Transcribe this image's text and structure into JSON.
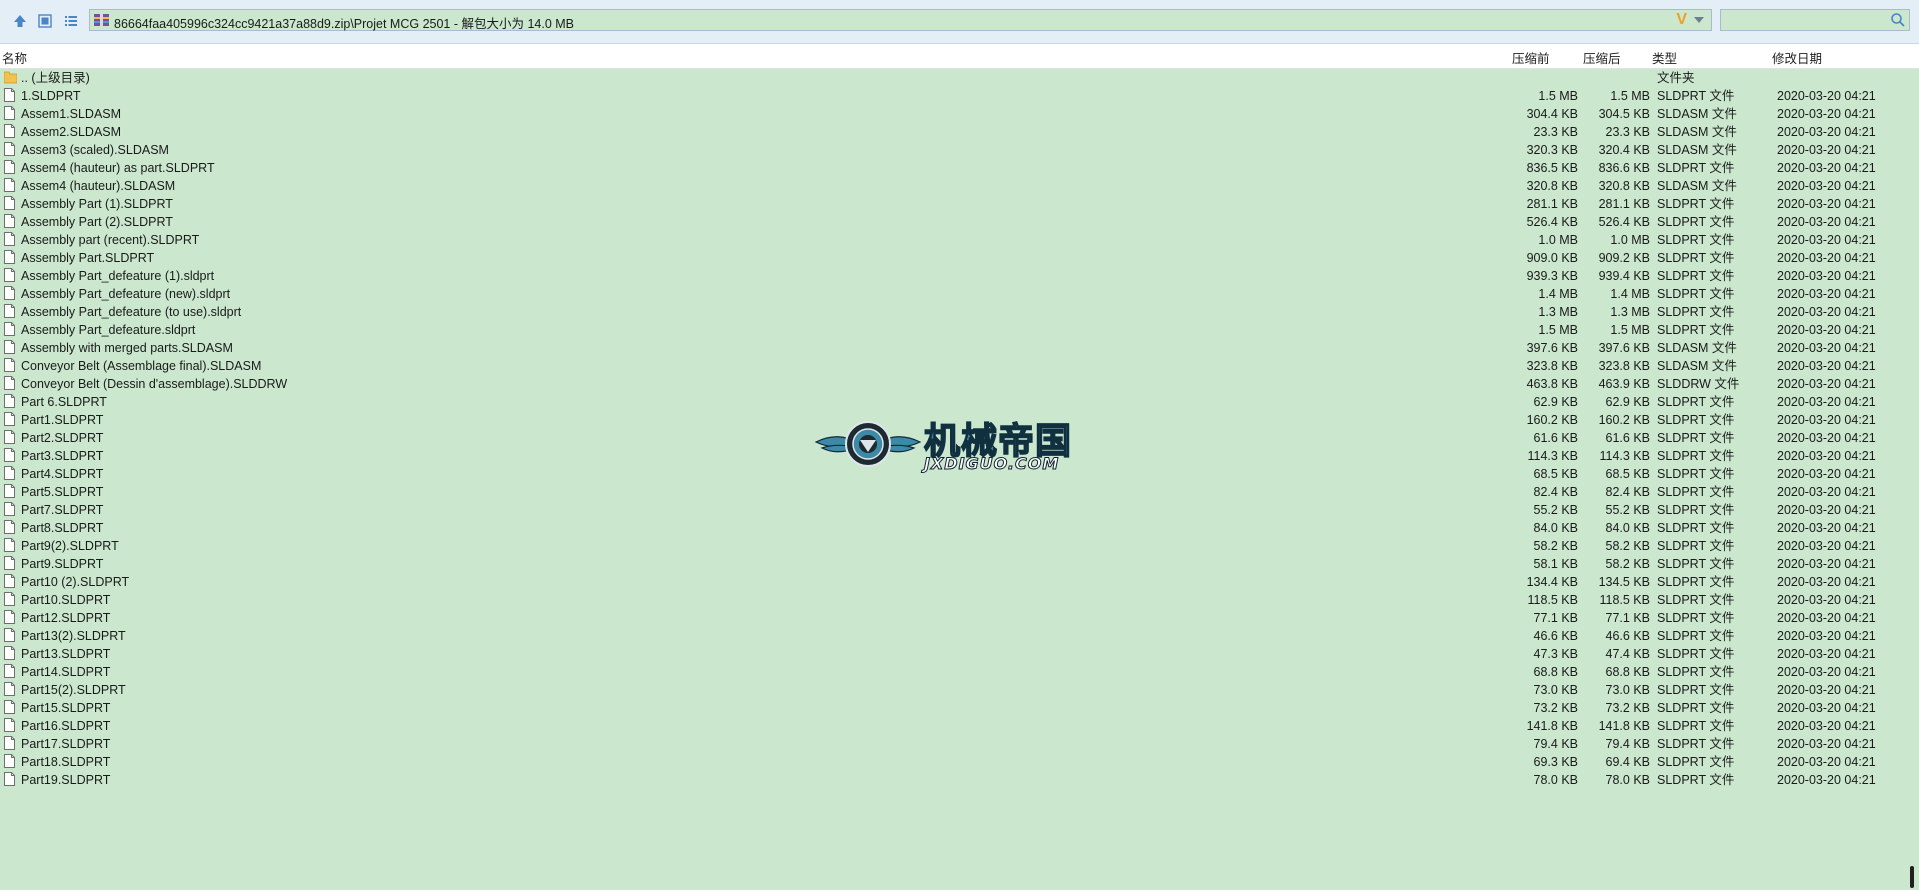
{
  "address": {
    "path": "86664faa405996c324cc9421a37a88d9.zip\\Projet MCG 2501 - 解包大小为 14.0 MB",
    "search_placeholder": ""
  },
  "columns": {
    "name": "名称",
    "compressed_before": "压缩前",
    "compressed_after": "压缩后",
    "type": "类型",
    "modified": "修改日期"
  },
  "watermark": {
    "brand_cn": "机械帝国",
    "brand_en": "JXDIGUO.COM"
  },
  "colors": {
    "background": "#cbe8cf",
    "toolbar": "#e3eef7",
    "header": "#ffffff",
    "folder": "#f2c14e",
    "accent_v": "#f0a020"
  },
  "rows": [
    {
      "name": ".. (上级目录)",
      "before": "",
      "after": "",
      "type": "文件夹",
      "date": "",
      "icon": "folder-icon"
    },
    {
      "name": "1.SLDPRT",
      "before": "1.5 MB",
      "after": "1.5 MB",
      "type": "SLDPRT 文件",
      "date": "2020-03-20 04:21",
      "icon": "file-icon"
    },
    {
      "name": "Assem1.SLDASM",
      "before": "304.4 KB",
      "after": "304.5 KB",
      "type": "SLDASM 文件",
      "date": "2020-03-20 04:21",
      "icon": "file-icon"
    },
    {
      "name": "Assem2.SLDASM",
      "before": "23.3 KB",
      "after": "23.3 KB",
      "type": "SLDASM 文件",
      "date": "2020-03-20 04:21",
      "icon": "file-icon"
    },
    {
      "name": "Assem3 (scaled).SLDASM",
      "before": "320.3 KB",
      "after": "320.4 KB",
      "type": "SLDASM 文件",
      "date": "2020-03-20 04:21",
      "icon": "file-icon"
    },
    {
      "name": "Assem4 (hauteur) as part.SLDPRT",
      "before": "836.5 KB",
      "after": "836.6 KB",
      "type": "SLDPRT 文件",
      "date": "2020-03-20 04:21",
      "icon": "file-icon"
    },
    {
      "name": "Assem4 (hauteur).SLDASM",
      "before": "320.8 KB",
      "after": "320.8 KB",
      "type": "SLDASM 文件",
      "date": "2020-03-20 04:21",
      "icon": "file-icon"
    },
    {
      "name": "Assembly Part (1).SLDPRT",
      "before": "281.1 KB",
      "after": "281.1 KB",
      "type": "SLDPRT 文件",
      "date": "2020-03-20 04:21",
      "icon": "file-icon"
    },
    {
      "name": "Assembly Part (2).SLDPRT",
      "before": "526.4 KB",
      "after": "526.4 KB",
      "type": "SLDPRT 文件",
      "date": "2020-03-20 04:21",
      "icon": "file-icon"
    },
    {
      "name": "Assembly part (recent).SLDPRT",
      "before": "1.0 MB",
      "after": "1.0 MB",
      "type": "SLDPRT 文件",
      "date": "2020-03-20 04:21",
      "icon": "file-icon"
    },
    {
      "name": "Assembly Part.SLDPRT",
      "before": "909.0 KB",
      "after": "909.2 KB",
      "type": "SLDPRT 文件",
      "date": "2020-03-20 04:21",
      "icon": "file-icon"
    },
    {
      "name": "Assembly Part_defeature (1).sldprt",
      "before": "939.3 KB",
      "after": "939.4 KB",
      "type": "SLDPRT 文件",
      "date": "2020-03-20 04:21",
      "icon": "file-icon"
    },
    {
      "name": "Assembly Part_defeature (new).sldprt",
      "before": "1.4 MB",
      "after": "1.4 MB",
      "type": "SLDPRT 文件",
      "date": "2020-03-20 04:21",
      "icon": "file-icon"
    },
    {
      "name": "Assembly Part_defeature (to use).sldprt",
      "before": "1.3 MB",
      "after": "1.3 MB",
      "type": "SLDPRT 文件",
      "date": "2020-03-20 04:21",
      "icon": "file-icon"
    },
    {
      "name": "Assembly Part_defeature.sldprt",
      "before": "1.5 MB",
      "after": "1.5 MB",
      "type": "SLDPRT 文件",
      "date": "2020-03-20 04:21",
      "icon": "file-icon"
    },
    {
      "name": "Assembly with merged parts.SLDASM",
      "before": "397.6 KB",
      "after": "397.6 KB",
      "type": "SLDASM 文件",
      "date": "2020-03-20 04:21",
      "icon": "file-icon"
    },
    {
      "name": "Conveyor Belt (Assemblage final).SLDASM",
      "before": "323.8 KB",
      "after": "323.8 KB",
      "type": "SLDASM 文件",
      "date": "2020-03-20 04:21",
      "icon": "file-icon"
    },
    {
      "name": "Conveyor Belt (Dessin d'assemblage).SLDDRW",
      "before": "463.8 KB",
      "after": "463.9 KB",
      "type": "SLDDRW 文件",
      "date": "2020-03-20 04:21",
      "icon": "file-icon"
    },
    {
      "name": "Part 6.SLDPRT",
      "before": "62.9 KB",
      "after": "62.9 KB",
      "type": "SLDPRT 文件",
      "date": "2020-03-20 04:21",
      "icon": "file-icon"
    },
    {
      "name": "Part1.SLDPRT",
      "before": "160.2 KB",
      "after": "160.2 KB",
      "type": "SLDPRT 文件",
      "date": "2020-03-20 04:21",
      "icon": "file-icon"
    },
    {
      "name": "Part2.SLDPRT",
      "before": "61.6 KB",
      "after": "61.6 KB",
      "type": "SLDPRT 文件",
      "date": "2020-03-20 04:21",
      "icon": "file-icon"
    },
    {
      "name": "Part3.SLDPRT",
      "before": "114.3 KB",
      "after": "114.3 KB",
      "type": "SLDPRT 文件",
      "date": "2020-03-20 04:21",
      "icon": "file-icon"
    },
    {
      "name": "Part4.SLDPRT",
      "before": "68.5 KB",
      "after": "68.5 KB",
      "type": "SLDPRT 文件",
      "date": "2020-03-20 04:21",
      "icon": "file-icon"
    },
    {
      "name": "Part5.SLDPRT",
      "before": "82.4 KB",
      "after": "82.4 KB",
      "type": "SLDPRT 文件",
      "date": "2020-03-20 04:21",
      "icon": "file-icon"
    },
    {
      "name": "Part7.SLDPRT",
      "before": "55.2 KB",
      "after": "55.2 KB",
      "type": "SLDPRT 文件",
      "date": "2020-03-20 04:21",
      "icon": "file-icon"
    },
    {
      "name": "Part8.SLDPRT",
      "before": "84.0 KB",
      "after": "84.0 KB",
      "type": "SLDPRT 文件",
      "date": "2020-03-20 04:21",
      "icon": "file-icon"
    },
    {
      "name": "Part9(2).SLDPRT",
      "before": "58.2 KB",
      "after": "58.2 KB",
      "type": "SLDPRT 文件",
      "date": "2020-03-20 04:21",
      "icon": "file-icon"
    },
    {
      "name": "Part9.SLDPRT",
      "before": "58.1 KB",
      "after": "58.2 KB",
      "type": "SLDPRT 文件",
      "date": "2020-03-20 04:21",
      "icon": "file-icon"
    },
    {
      "name": "Part10 (2).SLDPRT",
      "before": "134.4 KB",
      "after": "134.5 KB",
      "type": "SLDPRT 文件",
      "date": "2020-03-20 04:21",
      "icon": "file-icon"
    },
    {
      "name": "Part10.SLDPRT",
      "before": "118.5 KB",
      "after": "118.5 KB",
      "type": "SLDPRT 文件",
      "date": "2020-03-20 04:21",
      "icon": "file-icon"
    },
    {
      "name": "Part12.SLDPRT",
      "before": "77.1 KB",
      "after": "77.1 KB",
      "type": "SLDPRT 文件",
      "date": "2020-03-20 04:21",
      "icon": "file-icon"
    },
    {
      "name": "Part13(2).SLDPRT",
      "before": "46.6 KB",
      "after": "46.6 KB",
      "type": "SLDPRT 文件",
      "date": "2020-03-20 04:21",
      "icon": "file-icon"
    },
    {
      "name": "Part13.SLDPRT",
      "before": "47.3 KB",
      "after": "47.4 KB",
      "type": "SLDPRT 文件",
      "date": "2020-03-20 04:21",
      "icon": "file-icon"
    },
    {
      "name": "Part14.SLDPRT",
      "before": "68.8 KB",
      "after": "68.8 KB",
      "type": "SLDPRT 文件",
      "date": "2020-03-20 04:21",
      "icon": "file-icon"
    },
    {
      "name": "Part15(2).SLDPRT",
      "before": "73.0 KB",
      "after": "73.0 KB",
      "type": "SLDPRT 文件",
      "date": "2020-03-20 04:21",
      "icon": "file-icon"
    },
    {
      "name": "Part15.SLDPRT",
      "before": "73.2 KB",
      "after": "73.2 KB",
      "type": "SLDPRT 文件",
      "date": "2020-03-20 04:21",
      "icon": "file-icon"
    },
    {
      "name": "Part16.SLDPRT",
      "before": "141.8 KB",
      "after": "141.8 KB",
      "type": "SLDPRT 文件",
      "date": "2020-03-20 04:21",
      "icon": "file-icon"
    },
    {
      "name": "Part17.SLDPRT",
      "before": "79.4 KB",
      "after": "79.4 KB",
      "type": "SLDPRT 文件",
      "date": "2020-03-20 04:21",
      "icon": "file-icon"
    },
    {
      "name": "Part18.SLDPRT",
      "before": "69.3 KB",
      "after": "69.4 KB",
      "type": "SLDPRT 文件",
      "date": "2020-03-20 04:21",
      "icon": "file-icon"
    },
    {
      "name": "Part19.SLDPRT",
      "before": "78.0 KB",
      "after": "78.0 KB",
      "type": "SLDPRT 文件",
      "date": "2020-03-20 04:21",
      "icon": "file-icon"
    }
  ]
}
